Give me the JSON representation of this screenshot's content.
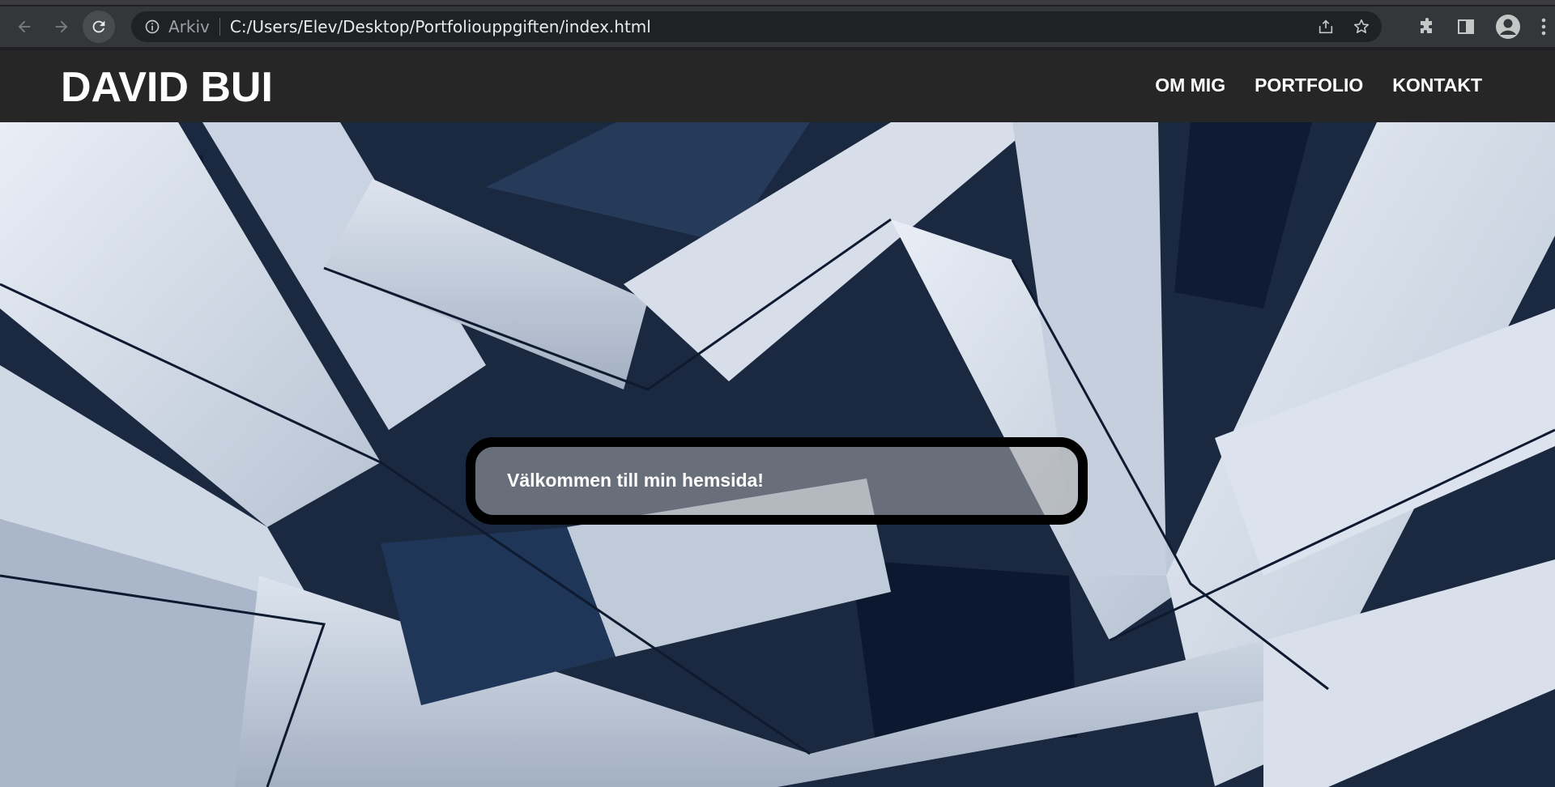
{
  "browser": {
    "scheme_label": "Arkiv",
    "url": "C:/Users/Elev/Desktop/Portfoliouppgiften/index.html",
    "icons": [
      "back-arrow-icon",
      "forward-arrow-icon",
      "reload-icon",
      "info-icon",
      "share-icon",
      "star-icon",
      "extensions-icon",
      "side-panel-icon",
      "profile-icon",
      "menu-icon"
    ]
  },
  "site": {
    "logo": "DAVID BUI",
    "nav": [
      "OM MIG",
      "PORTFOLIO",
      "KONTAKT"
    ],
    "welcome": "Välkommen till min hemsida!"
  },
  "colors": {
    "header_bg": "#262626",
    "box_border": "#000000"
  }
}
